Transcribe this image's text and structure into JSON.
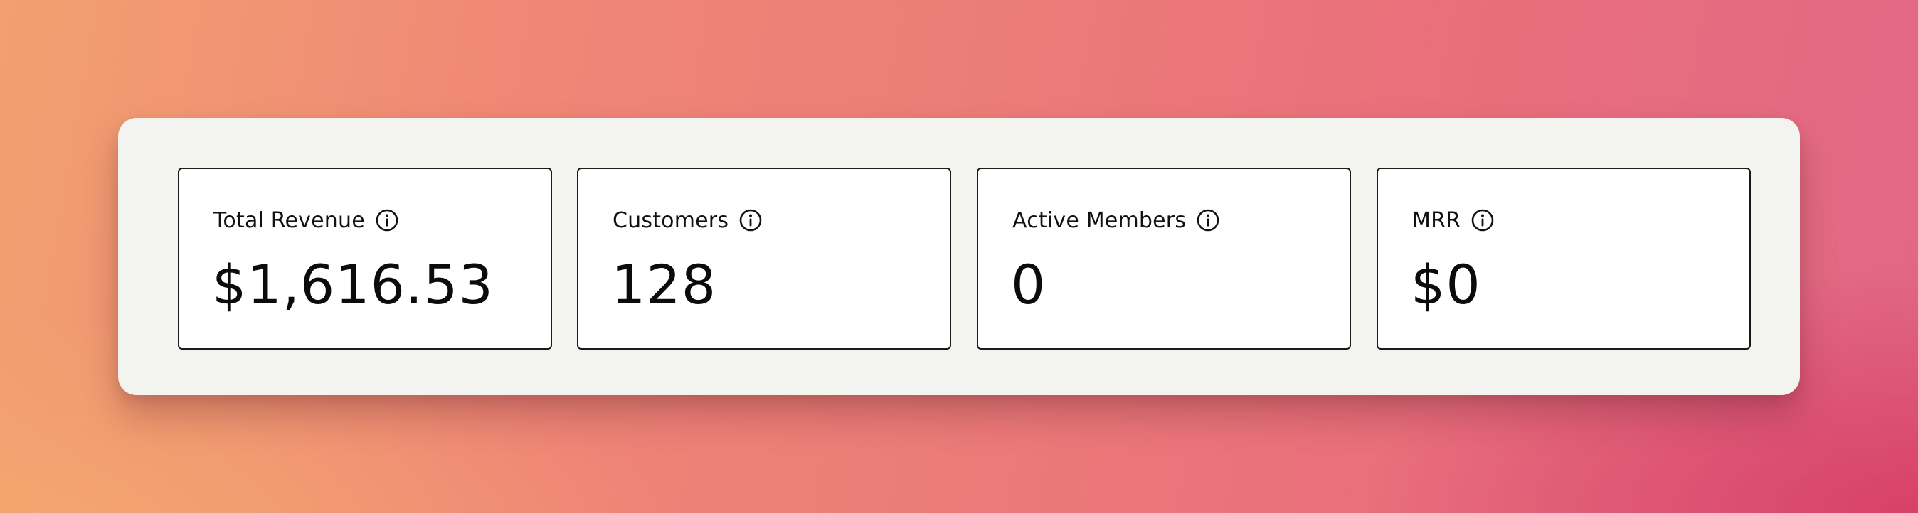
{
  "stats": [
    {
      "label": "Total Revenue",
      "value": "$1,616.53",
      "info_icon": "info-icon"
    },
    {
      "label": "Customers",
      "value": "128",
      "info_icon": "info-icon"
    },
    {
      "label": "Active Members",
      "value": "0",
      "info_icon": "info-icon"
    },
    {
      "label": "MRR",
      "value": "$0",
      "info_icon": "info-icon"
    }
  ],
  "colors": {
    "panel_background": "#f3f3ef",
    "card_background": "#ffffff",
    "card_border": "#1a1a1a",
    "text": "#111111"
  }
}
